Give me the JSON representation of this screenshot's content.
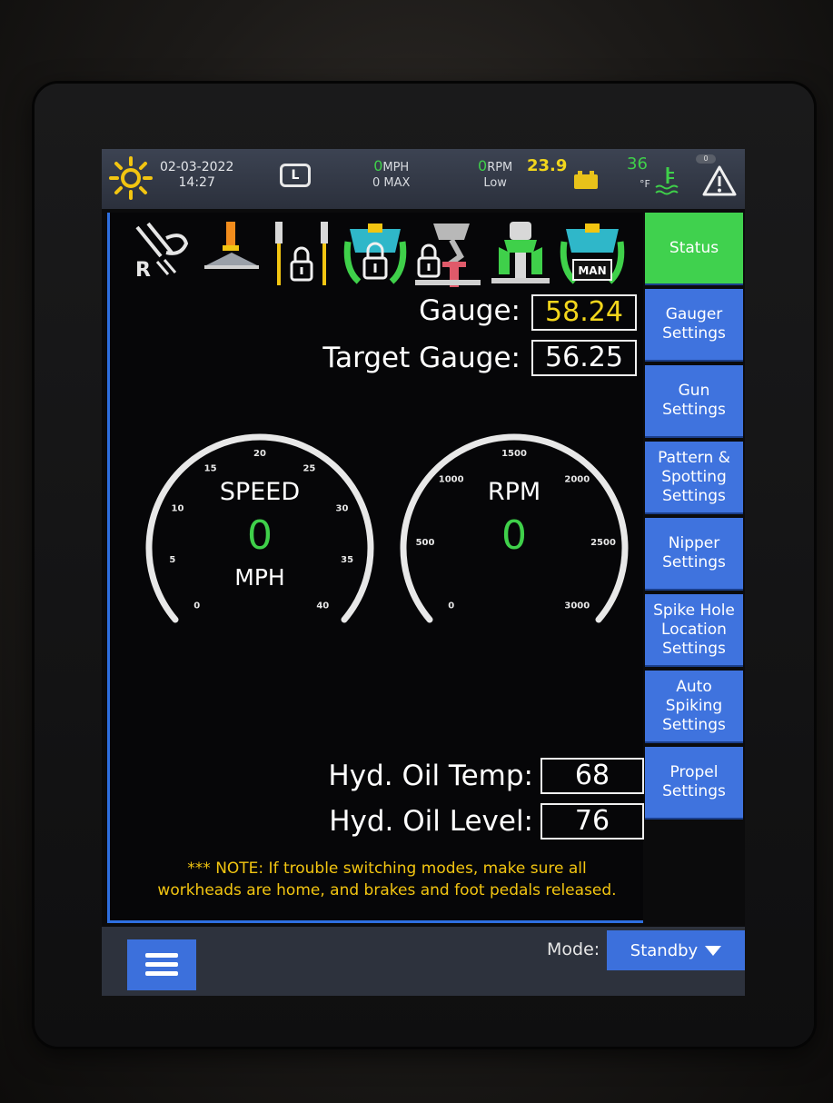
{
  "status_bar": {
    "date": "02-03-2022",
    "time": "14:27",
    "l_badge": "L",
    "speed_value": "0",
    "speed_unit": "MPH",
    "speed_sub": "0 MAX",
    "rpm_value": "0",
    "rpm_unit": "RPM",
    "rpm_sub": "Low",
    "battery_voltage": "23.9",
    "temperature": "36",
    "temperature_unit": "°F",
    "pill_label": "0",
    "icons": [
      "sun-icon",
      "battery-icon",
      "coolant-icon",
      "warning-icon"
    ]
  },
  "workhead_icons": [
    "rail-r-icon",
    "spot-gun-icon",
    "locked-pins-icon",
    "locked-clamp-icon",
    "locked-nipper-icon",
    "spiker-icon",
    "manual-clamp-icon"
  ],
  "workhead_man_label": "MAN",
  "gauge": {
    "label": "Gauge:",
    "value": "58.24",
    "target_label": "Target Gauge:",
    "target_value": "56.25"
  },
  "speed_dial": {
    "title": "SPEED",
    "value": "0",
    "unit": "MPH",
    "ticks": [
      "0",
      "5",
      "10",
      "15",
      "20",
      "25",
      "30",
      "35",
      "40"
    ]
  },
  "rpm_dial": {
    "title": "RPM",
    "value": "0",
    "ticks": [
      "0",
      "500",
      "1000",
      "1500",
      "2000",
      "2500",
      "3000"
    ]
  },
  "oil": {
    "temp_label": "Hyd. Oil Temp:",
    "temp_value": "68",
    "level_label": "Hyd. Oil Level:",
    "level_value": "76"
  },
  "note": "*** NOTE: If trouble switching modes, make sure all workheads are home, and brakes and foot pedals released.",
  "nav": [
    "Status",
    "Gauger\nSettings",
    "Gun\nSettings",
    "Pattern &\nSpotting\nSettings",
    "Nipper\nSettings",
    "Spike Hole\nLocation\nSettings",
    "Auto\nSpiking\nSettings",
    "Propel\nSettings"
  ],
  "nav_active_index": 0,
  "bottom": {
    "mode_label": "Mode:",
    "mode_value": "Standby",
    "menu_icon": "hamburger-menu-icon"
  },
  "colors": {
    "accent_blue": "#3f73de",
    "active_green": "#40d14e",
    "value_green": "#3fd04a",
    "gauge_yellow": "#f2d61c",
    "note_yellow": "#f2c511"
  }
}
